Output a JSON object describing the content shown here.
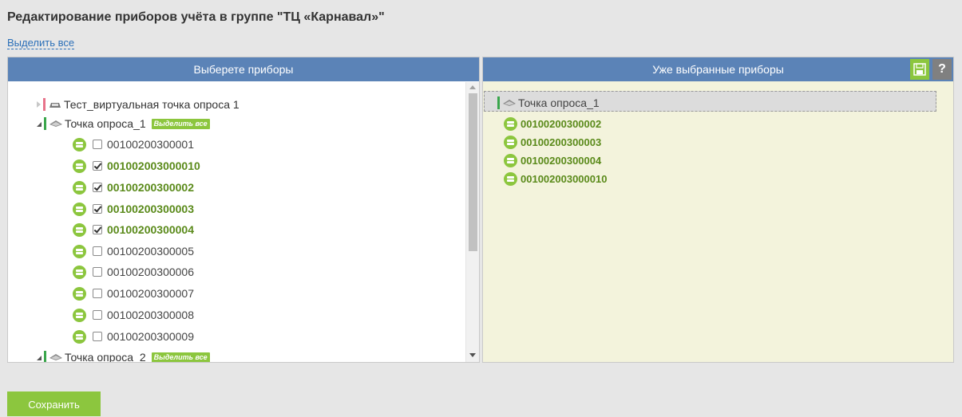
{
  "page": {
    "title": "Редактирование приборов учёта в группе \"ТЦ «Карнавал»\"",
    "select_all_link": "Выделить все"
  },
  "left_panel": {
    "header": "Выберете приборы",
    "nodes": [
      {
        "label": "Тест_виртуальная точка опроса 1",
        "expanded": false,
        "status": "red"
      },
      {
        "label": "Точка опроса_1",
        "expanded": true,
        "status": "green",
        "badge": "Выделить все",
        "devices": [
          {
            "label": "00100200300001",
            "checked": false
          },
          {
            "label": "001002003000010",
            "checked": true
          },
          {
            "label": "00100200300002",
            "checked": true
          },
          {
            "label": "00100200300003",
            "checked": true
          },
          {
            "label": "00100200300004",
            "checked": true
          },
          {
            "label": "00100200300005",
            "checked": false
          },
          {
            "label": "00100200300006",
            "checked": false
          },
          {
            "label": "00100200300007",
            "checked": false
          },
          {
            "label": "00100200300008",
            "checked": false
          },
          {
            "label": "00100200300009",
            "checked": false
          }
        ]
      },
      {
        "label": "Точка опроса_2",
        "expanded": true,
        "status": "green",
        "badge": "Выделить все"
      }
    ]
  },
  "right_panel": {
    "header": "Уже выбранные приборы",
    "save_icon": "floppy-disk-icon",
    "help_label": "?",
    "node": {
      "label": "Точка опроса_1"
    },
    "devices": [
      "00100200300002",
      "00100200300003",
      "00100200300004",
      "001002003000010"
    ]
  },
  "footer": {
    "save_button": "Сохранить"
  },
  "colors": {
    "header_bg": "#5b83b7",
    "accent_green": "#8cc63e",
    "selected_text": "#5a8a1a",
    "right_bg": "#f3f3dc"
  }
}
